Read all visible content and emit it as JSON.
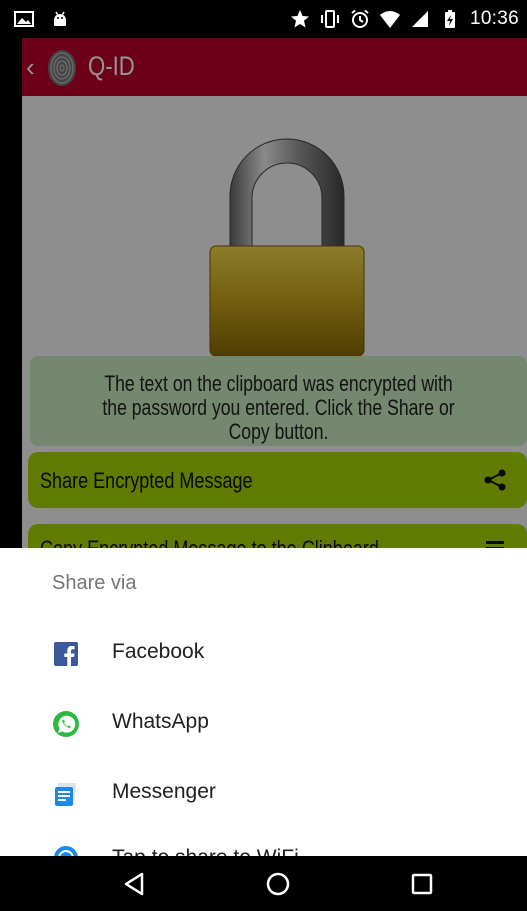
{
  "status_bar": {
    "time": "10:36"
  },
  "app": {
    "title": "Q-ID",
    "info_text": "The text on the clipboard was encrypted with the password you entered. Click the Share or Copy button.",
    "share_button": "Share Encrypted Message",
    "copy_button": "Copy Encrypted Message to the Clipboard",
    "colors": {
      "toolbar": "#b8002a",
      "button": "#a8d200",
      "info_box": "#c9ebbf"
    }
  },
  "share_sheet": {
    "title": "Share via",
    "items": [
      {
        "label": "Facebook",
        "icon": "facebook-icon"
      },
      {
        "label": "WhatsApp",
        "icon": "whatsapp-icon"
      },
      {
        "label": "Messenger",
        "icon": "messenger-icon"
      },
      {
        "label": "Tap to share to WiFi",
        "icon": "wifi-share-icon"
      }
    ]
  },
  "nav_bar": {
    "icons": [
      "back-icon",
      "home-icon",
      "recents-icon"
    ]
  }
}
